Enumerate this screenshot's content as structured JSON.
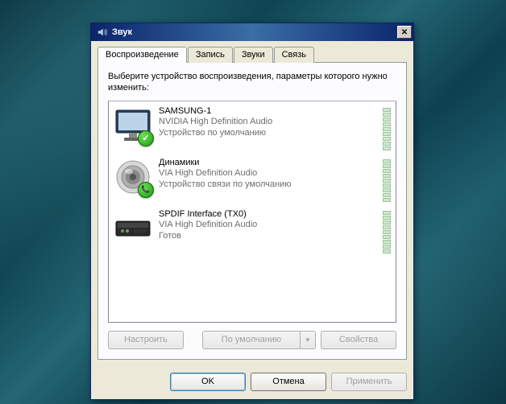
{
  "window": {
    "title": "Звук"
  },
  "tabs": {
    "playback": "Воспроизведение",
    "recording": "Запись",
    "sounds": "Звуки",
    "comms": "Связь"
  },
  "instruction": "Выберите устройство воспроизведения, параметры которого нужно изменить:",
  "devices": [
    {
      "name": "SAMSUNG-1",
      "driver": "NVIDIA High Definition Audio",
      "status": "Устройство по умолчанию",
      "badge": "✓"
    },
    {
      "name": "Динамики",
      "driver": "VIA High Definition Audio",
      "status": "Устройство связи по умолчанию",
      "badge": "📞"
    },
    {
      "name": "SPDIF Interface (TX0)",
      "driver": "VIA High Definition Audio",
      "status": "Готов",
      "badge": ""
    }
  ],
  "buttons": {
    "configure": "Настроить",
    "setdefault": "По умолчанию",
    "properties": "Свойства",
    "ok": "OK",
    "cancel": "Отмена",
    "apply": "Применить"
  }
}
